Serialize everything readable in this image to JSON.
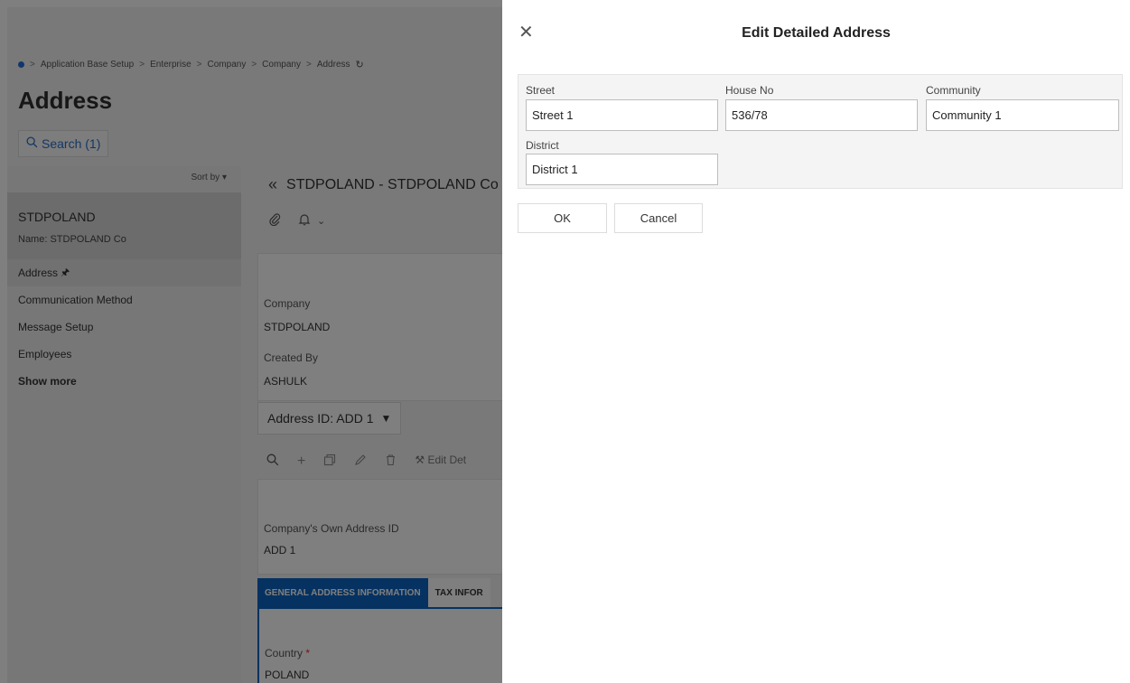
{
  "breadcrumb": {
    "items": [
      "Application Base Setup",
      "Enterprise",
      "Company",
      "Company",
      "Address"
    ],
    "separator": ">"
  },
  "page": {
    "title": "Address",
    "search_label": "Search (1)"
  },
  "sidebar": {
    "sort_label": "Sort by",
    "record": {
      "title": "STDPOLAND",
      "subtitle": "Name:  STDPOLAND Co"
    },
    "items": [
      {
        "label": "Address"
      },
      {
        "label": "Communication Method"
      },
      {
        "label": "Message Setup"
      },
      {
        "label": "Employees"
      },
      {
        "label": "Show more"
      }
    ]
  },
  "main": {
    "record_selector": "STDPOLAND - STDPOLAND Co",
    "header_fields": [
      {
        "label": "Company",
        "value": "STDPOLAND"
      },
      {
        "label": "Created By",
        "value": "ASHULK"
      }
    ],
    "address_selector": "Address ID: ADD 1",
    "list_tools_edit_label": "Edit Det",
    "own_address": {
      "label": "Company's Own Address ID",
      "value": "ADD 1"
    },
    "tabs": [
      {
        "label": "GENERAL ADDRESS INFORMATION"
      },
      {
        "label": "TAX INFOR"
      }
    ],
    "country": {
      "label": "Country",
      "required_mark": "*",
      "value": "POLAND"
    }
  },
  "dialog": {
    "title": "Edit Detailed Address",
    "fields": [
      {
        "label": "Street",
        "value": "Street 1"
      },
      {
        "label": "House No",
        "value": "536/78"
      },
      {
        "label": "Community",
        "value": "Community 1"
      },
      {
        "label": "District",
        "value": "District 1"
      }
    ],
    "ok_label": "OK",
    "cancel_label": "Cancel"
  },
  "colors": {
    "accent": "#0b65c2",
    "link": "#2b6fc7",
    "required": "#d9342b"
  }
}
